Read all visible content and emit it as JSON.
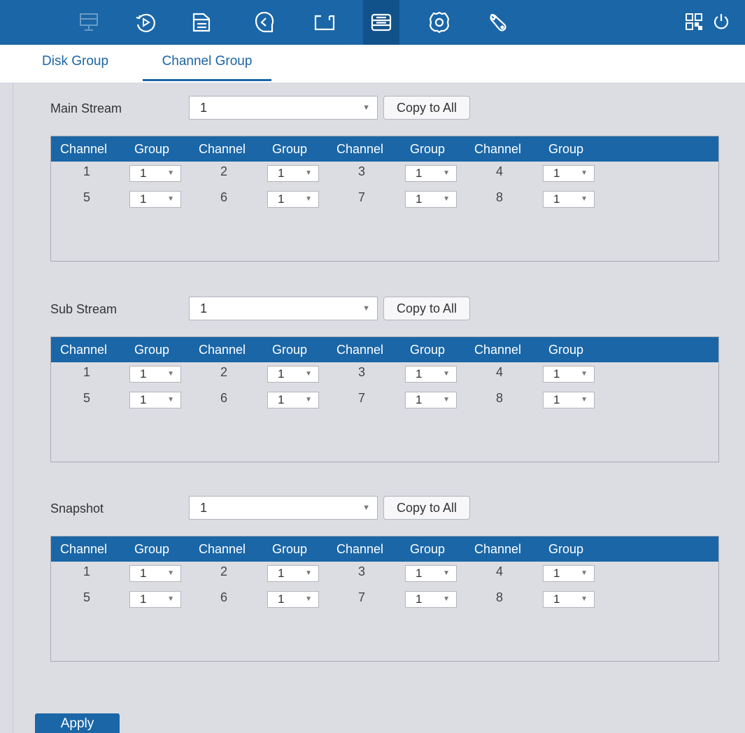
{
  "nav": {
    "icons": [
      "monitor-icon",
      "playback-icon",
      "file-icon",
      "face-icon",
      "camera-icon",
      "storage-icon",
      "settings-icon",
      "wrench-icon"
    ],
    "right_icons": [
      "qr-code-icon",
      "power-icon"
    ],
    "active_index": 5,
    "accent_color": "#1a66a7"
  },
  "tabs": {
    "disk_group": "Disk Group",
    "channel_group": "Channel Group",
    "active": "Channel Group"
  },
  "sections": [
    {
      "label": "Main Stream",
      "select_value": "1",
      "copy_label": "Copy to All",
      "headers": [
        "Channel",
        "Group",
        "Channel",
        "Group",
        "Channel",
        "Group",
        "Channel",
        "Group"
      ],
      "rows": [
        [
          {
            "channel": "1",
            "group": "1"
          },
          {
            "channel": "2",
            "group": "1"
          },
          {
            "channel": "3",
            "group": "1"
          },
          {
            "channel": "4",
            "group": "1"
          }
        ],
        [
          {
            "channel": "5",
            "group": "1"
          },
          {
            "channel": "6",
            "group": "1"
          },
          {
            "channel": "7",
            "group": "1"
          },
          {
            "channel": "8",
            "group": "1"
          }
        ]
      ]
    },
    {
      "label": "Sub Stream",
      "select_value": "1",
      "copy_label": "Copy to All",
      "headers": [
        "Channel",
        "Group",
        "Channel",
        "Group",
        "Channel",
        "Group",
        "Channel",
        "Group"
      ],
      "rows": [
        [
          {
            "channel": "1",
            "group": "1"
          },
          {
            "channel": "2",
            "group": "1"
          },
          {
            "channel": "3",
            "group": "1"
          },
          {
            "channel": "4",
            "group": "1"
          }
        ],
        [
          {
            "channel": "5",
            "group": "1"
          },
          {
            "channel": "6",
            "group": "1"
          },
          {
            "channel": "7",
            "group": "1"
          },
          {
            "channel": "8",
            "group": "1"
          }
        ]
      ]
    },
    {
      "label": "Snapshot",
      "select_value": "1",
      "copy_label": "Copy to All",
      "headers": [
        "Channel",
        "Group",
        "Channel",
        "Group",
        "Channel",
        "Group",
        "Channel",
        "Group"
      ],
      "rows": [
        [
          {
            "channel": "1",
            "group": "1"
          },
          {
            "channel": "2",
            "group": "1"
          },
          {
            "channel": "3",
            "group": "1"
          },
          {
            "channel": "4",
            "group": "1"
          }
        ],
        [
          {
            "channel": "5",
            "group": "1"
          },
          {
            "channel": "6",
            "group": "1"
          },
          {
            "channel": "7",
            "group": "1"
          },
          {
            "channel": "8",
            "group": "1"
          }
        ]
      ]
    }
  ],
  "footer": {
    "apply_label": "Apply"
  }
}
